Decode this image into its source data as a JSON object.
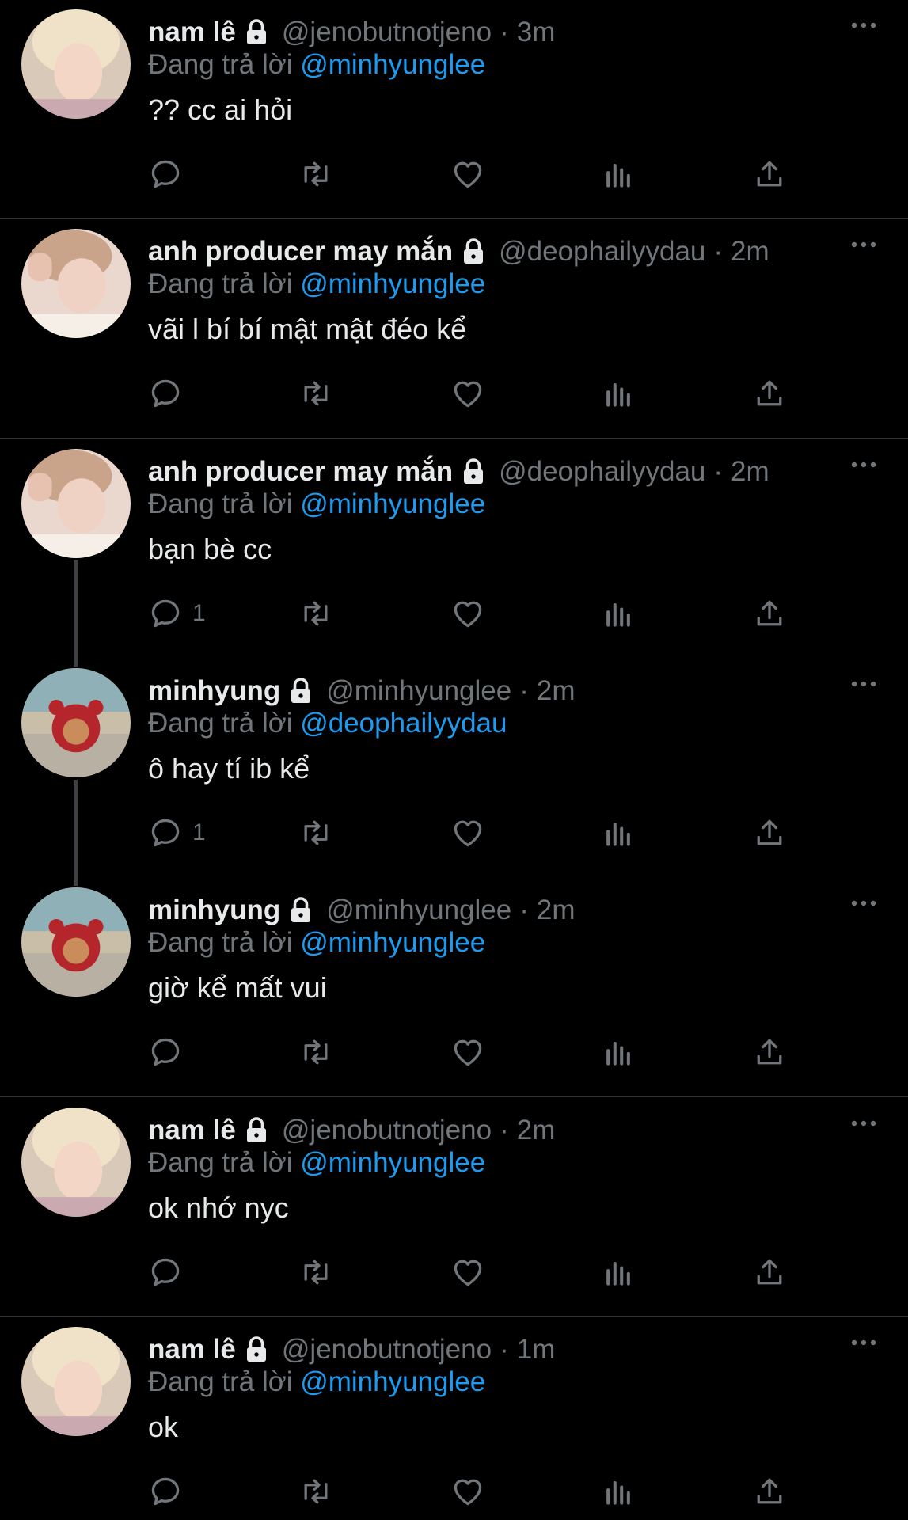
{
  "colors": {
    "background": "#000000",
    "text": "#e7e9ea",
    "muted": "#71767b",
    "accent": "#1d9bf0",
    "divider": "#2f3336"
  },
  "icons": {
    "reply": "reply-icon",
    "retweet": "retweet-icon",
    "like": "heart-icon",
    "views": "bar-chart-icon",
    "share": "share-icon",
    "more": "more-icon",
    "lock": "lock-icon"
  },
  "tweets": [
    {
      "name": "nam lê",
      "handle": "@jenobutnotjeno",
      "dot": "·",
      "time": "3m",
      "replying_label": "Đang trả lời",
      "replying_to": "@minhyunglee",
      "text": "?? cc ai hỏi",
      "reply_count": ""
    },
    {
      "name": "anh producer may mắn",
      "handle": "@deophailyydau",
      "dot": "·",
      "time": "2m",
      "replying_label": "Đang trả lời",
      "replying_to": "@minhyunglee",
      "text": "vãi l bí bí mật mật đéo kể",
      "reply_count": ""
    },
    {
      "name": "anh producer may mắn",
      "handle": "@deophailyydau",
      "dot": "·",
      "time": "2m",
      "replying_label": "Đang trả lời",
      "replying_to": "@minhyunglee",
      "text": "bạn bè cc",
      "reply_count": "1"
    },
    {
      "name": "minhyung",
      "handle": "@minhyunglee",
      "dot": "·",
      "time": "2m",
      "replying_label": "Đang trả lời",
      "replying_to": "@deophailyydau",
      "text": "ô hay tí ib kể",
      "reply_count": "1"
    },
    {
      "name": "minhyung",
      "handle": "@minhyunglee",
      "dot": "·",
      "time": "2m",
      "replying_label": "Đang trả lời",
      "replying_to": "@minhyunglee",
      "text": "giờ kể mất vui",
      "reply_count": ""
    },
    {
      "name": "nam lê",
      "handle": "@jenobutnotjeno",
      "dot": "·",
      "time": "2m",
      "replying_label": "Đang trả lời",
      "replying_to": "@minhyunglee",
      "text": "ok nhớ nyc",
      "reply_count": ""
    },
    {
      "name": "nam lê",
      "handle": "@jenobutnotjeno",
      "dot": "·",
      "time": "1m",
      "replying_label": "Đang trả lời",
      "replying_to": "@minhyunglee",
      "text": "ok",
      "reply_count": ""
    }
  ]
}
